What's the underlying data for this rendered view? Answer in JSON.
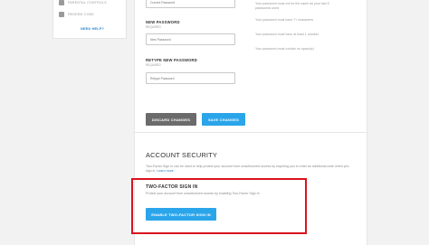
{
  "sidebar": {
    "items": [
      {
        "icon": "shield-icon",
        "label": "PARENTAL CONTROLS"
      },
      {
        "icon": "ticket-icon",
        "label": "REDEEM CODE"
      }
    ],
    "help_link": "NEED HELP?"
  },
  "form": {
    "current_password": {
      "placeholder": "Current Password"
    },
    "new_password": {
      "label": "NEW PASSWORD",
      "required": "REQUIRED",
      "placeholder": "New Password"
    },
    "retype_password": {
      "label": "RETYPE NEW PASSWORD",
      "required": "REQUIRED",
      "placeholder": "Retype Password"
    },
    "hints": [
      "Your password must not be the same as your last 5",
      "passwords used",
      "Your password must have 7+ characters",
      "Your password must have at least 1 number",
      "Your password must contain no space(s)"
    ],
    "discard_label": "DISCARD CHANGES",
    "save_label": "SAVE CHANGES"
  },
  "security": {
    "title": "ACCOUNT SECURITY",
    "description": "Two-Factor Sign In can be used to help protect your account from unauthorized access by requiring you to enter an additional code when you sign in.",
    "learn_more": "Learn more",
    "two_factor": {
      "title": "TWO-FACTOR SIGN IN",
      "description": "Protect your account from unauthorized access by enabling Two-Factor Sign In",
      "enable_label": "ENABLE TWO-FACTOR SIGN IN"
    }
  },
  "colors": {
    "accent": "#2ba5ea",
    "secondary_button": "#6b6b6b",
    "highlight": "#d9121e"
  }
}
